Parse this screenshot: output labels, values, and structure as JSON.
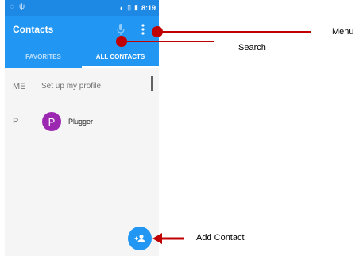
{
  "statusbar": {
    "time": "8:19"
  },
  "appbar": {
    "title": "Contacts"
  },
  "tabs": [
    {
      "label": "FAVORITES"
    },
    {
      "label": "ALL CONTACTS"
    }
  ],
  "me_row": {
    "section": "ME",
    "label": "Set up my profile"
  },
  "contact_row": {
    "section": "P",
    "avatar_letter": "P",
    "name": "Plugger"
  },
  "annotations": {
    "menu": "Menu",
    "search": "Search",
    "add_contact": "Add Contact"
  },
  "colors": {
    "primary": "#2196f3",
    "statusbar": "#1e88e5",
    "avatar": "#9c27b0",
    "callout": "#c00000"
  },
  "icons": [
    "usb-icon",
    "sync-icon",
    "signal-icon",
    "battery-icon",
    "microphone-icon",
    "menu-dots-icon",
    "add-person-icon"
  ]
}
